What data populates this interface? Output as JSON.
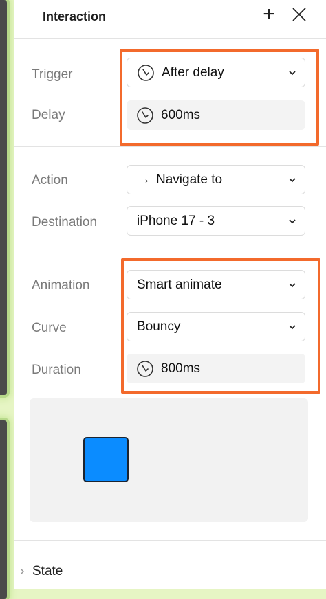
{
  "panel": {
    "title": "Interaction",
    "add_icon": "plus-icon",
    "close_icon": "close-icon"
  },
  "trigger_section": {
    "trigger": {
      "label": "Trigger",
      "value": "After delay",
      "icon": "timer-icon"
    },
    "delay": {
      "label": "Delay",
      "value": "600ms",
      "icon": "timer-icon"
    }
  },
  "action_section": {
    "action": {
      "label": "Action",
      "value": "Navigate to",
      "icon": "arrow-right-icon",
      "arrow_glyph": "→"
    },
    "destination": {
      "label": "Destination",
      "value": "iPhone 17 - 3"
    }
  },
  "animation_section": {
    "animation": {
      "label": "Animation",
      "value": "Smart animate"
    },
    "curve": {
      "label": "Curve",
      "value": "Bouncy"
    },
    "duration": {
      "label": "Duration",
      "value": "800ms",
      "icon": "timer-icon"
    }
  },
  "preview": {
    "shape_color": "#0b8cff"
  },
  "state": {
    "label": "State"
  },
  "colors": {
    "highlight": "#f36a2c",
    "accent": "#0b8cff"
  }
}
